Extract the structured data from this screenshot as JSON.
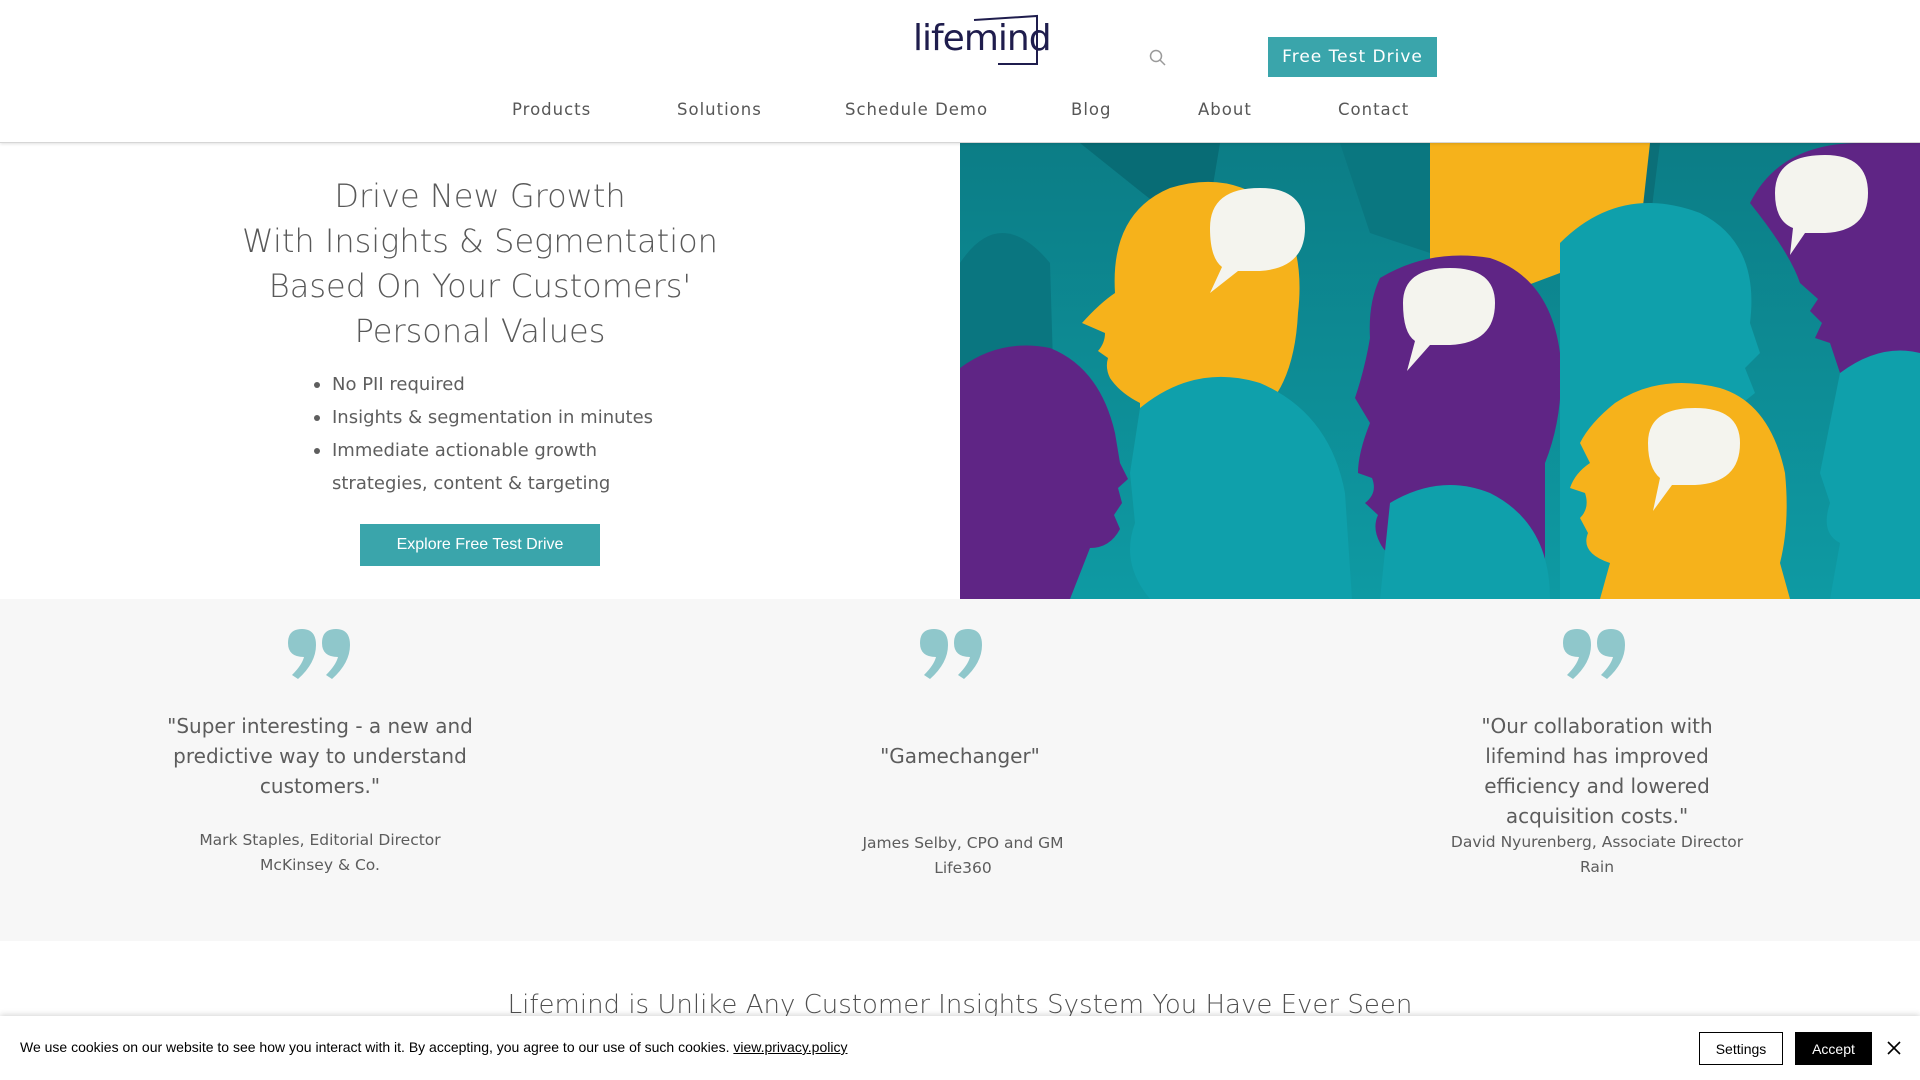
{
  "header": {
    "logo_text": "lifemind",
    "cta_label": "Free Test Drive",
    "search_icon": "search-icon",
    "nav": [
      {
        "label": "Products"
      },
      {
        "label": "Solutions"
      },
      {
        "label": "Schedule Demo"
      },
      {
        "label": "Blog"
      },
      {
        "label": "About"
      },
      {
        "label": "Contact"
      }
    ]
  },
  "hero": {
    "title_lines": [
      "Drive New Growth",
      "With Insights & Segmentation",
      "Based On Your Customers'",
      "Personal Values"
    ],
    "bullets": [
      "No PII required",
      "Insights & segmentation in minutes",
      "Immediate actionable growth strategies, content & targeting"
    ],
    "cta_label": "Explore Free Test Drive"
  },
  "testimonials": [
    {
      "quote": "\"Super interesting - a new and predictive way to understand customers.\"",
      "author": "Mark Staples, Editorial Director",
      "company": "McKinsey & Co."
    },
    {
      "quote": "\"Gamechanger\"",
      "author": "James Selby, CPO and GM",
      "company": "Life360"
    },
    {
      "quote": "\"Our collaboration with lifemind has improved efficiency and lowered acquisition costs.\"",
      "author": "David Nyurenberg, Associate Director",
      "company": "Rain"
    }
  ],
  "section": {
    "heading": "Lifemind is Unlike Any Customer Insights System You Have Ever Seen"
  },
  "cookie": {
    "text": "We use cookies on our website to see how you interact with it. By accepting, you agree to our use of such cookies.",
    "link_text": "view.privacy.policy",
    "settings_label": "Settings",
    "accept_label": "Accept",
    "close_icon": "close-icon"
  },
  "colors": {
    "accent": "#3aa5ab",
    "teal": "#0fa0ab",
    "purple": "#5f2585",
    "yellow": "#f6b21b",
    "quote_mark": "#8fc7cb"
  }
}
